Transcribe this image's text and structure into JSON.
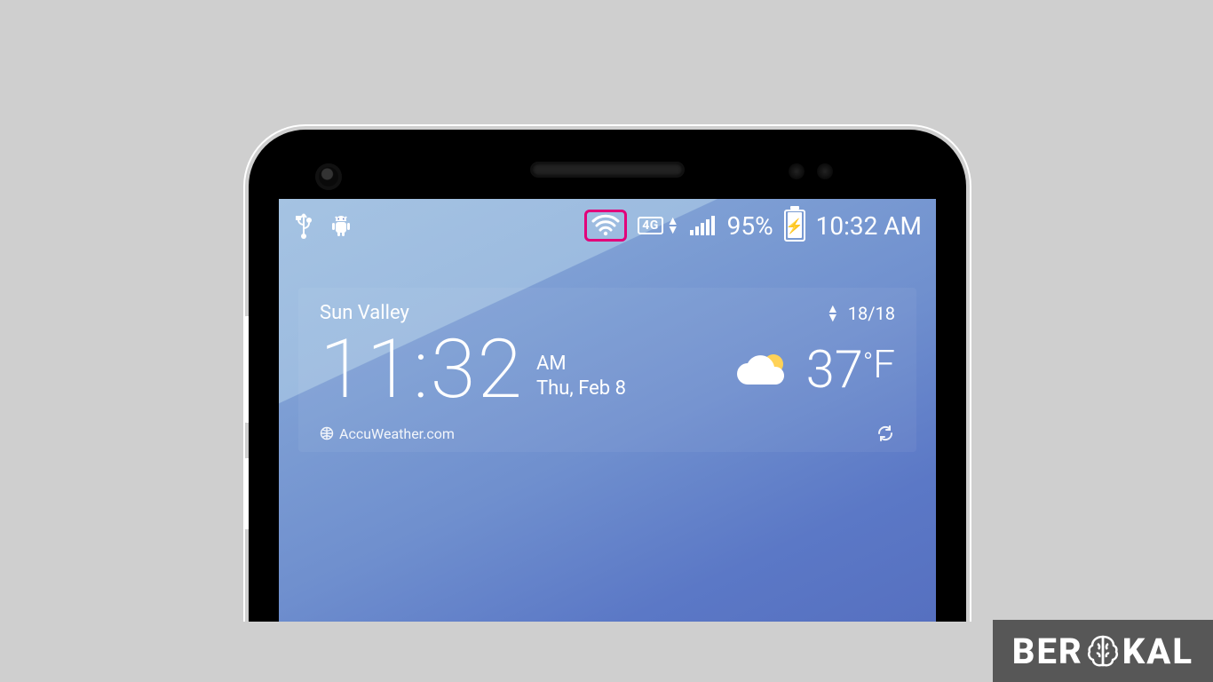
{
  "statusbar": {
    "network_badge": "4G",
    "battery_percent": "95%",
    "clock": "10:32 AM"
  },
  "widget": {
    "location": "Sun Valley",
    "page_indicator": "18/18",
    "clock": {
      "time": "11:32",
      "ampm": "AM",
      "date": "Thu, Feb 8"
    },
    "weather": {
      "temp_value": "37",
      "temp_degree": "°",
      "temp_unit": "F"
    },
    "source": "AccuWeather.com"
  },
  "watermark": {
    "part1": "BER",
    "part2": "KAL"
  }
}
